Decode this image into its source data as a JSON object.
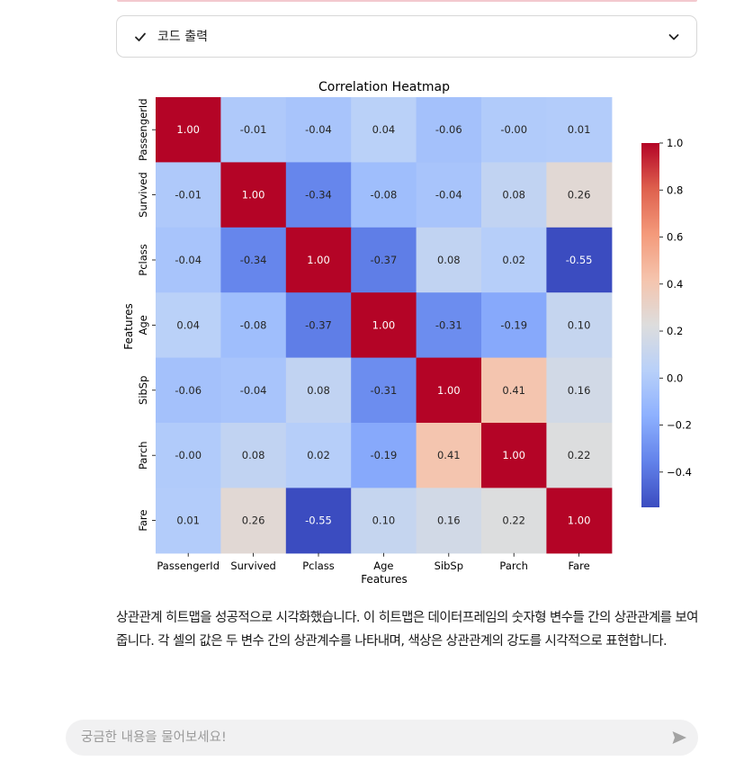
{
  "code_panel": {
    "label": "코드 출력",
    "status_icon": "check-icon",
    "toggle_icon": "chevron-down-icon"
  },
  "chart_data": {
    "type": "heatmap",
    "title": "Correlation Heatmap",
    "xlabel": "Features",
    "ylabel": "Features",
    "categories": [
      "PassengerId",
      "Survived",
      "Pclass",
      "Age",
      "SibSp",
      "Parch",
      "Fare"
    ],
    "matrix": [
      [
        1.0,
        -0.01,
        -0.04,
        0.04,
        -0.06,
        -0.0,
        0.01
      ],
      [
        -0.01,
        1.0,
        -0.34,
        -0.08,
        -0.04,
        0.08,
        0.26
      ],
      [
        -0.04,
        -0.34,
        1.0,
        -0.37,
        0.08,
        0.02,
        -0.55
      ],
      [
        0.04,
        -0.08,
        -0.37,
        1.0,
        -0.31,
        -0.19,
        0.1
      ],
      [
        -0.06,
        -0.04,
        0.08,
        -0.31,
        1.0,
        0.41,
        0.16
      ],
      [
        -0.0,
        0.08,
        0.02,
        -0.19,
        0.41,
        1.0,
        0.22
      ],
      [
        0.01,
        0.26,
        -0.55,
        0.1,
        0.16,
        0.22,
        1.0
      ]
    ],
    "colormap": "coolwarm",
    "colorbar": {
      "range": [
        -0.55,
        1.0
      ],
      "ticks": [
        1.0,
        0.8,
        0.6,
        0.4,
        0.2,
        0.0,
        -0.2,
        -0.4
      ],
      "tick_labels": [
        "1.0",
        "0.8",
        "0.6",
        "0.4",
        "0.2",
        "0.0",
        "−0.2",
        "−0.4"
      ]
    }
  },
  "message": {
    "text": "상관관계 히트맵을 성공적으로 시각화했습니다. 이 히트맵은 데이터프레임의 숫자형 변수들 간의 상관관계를 보여줍니다. 각 셀의 값은 두 변수 간의 상관계수를 나타내며, 색상은 상관관계의 강도를 시각적으로 표현합니다."
  },
  "chat_input": {
    "placeholder": "궁금한 내용을 물어보세요!",
    "value": "",
    "send_icon": "send-icon"
  }
}
